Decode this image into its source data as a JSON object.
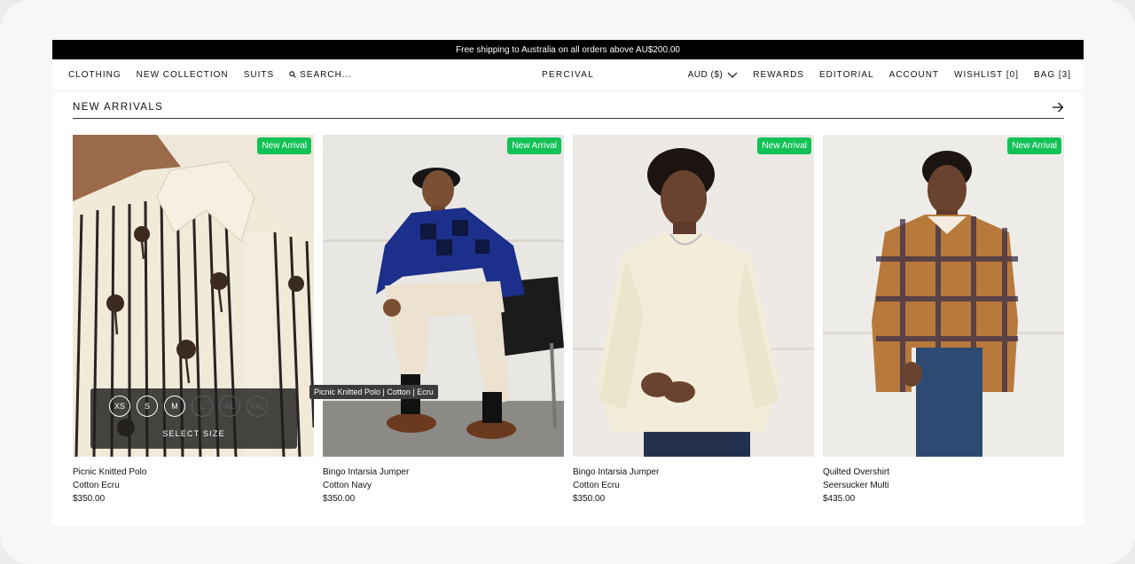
{
  "promo_bar": {
    "text": "Free shipping to Australia on all orders above AU$200.00"
  },
  "nav": {
    "left": [
      "CLOTHING",
      "NEW COLLECTION",
      "SUITS"
    ],
    "search_label": "SEARCH...",
    "brand": "PERCIVAL",
    "currency": "AUD ($)",
    "right": [
      "REWARDS",
      "EDITORIAL",
      "ACCOUNT",
      "WISHLIST [0]",
      "BAG [3]"
    ]
  },
  "section": {
    "title": "NEW ARRIVALS"
  },
  "products": [
    {
      "name": "Picnic Knitted Polo",
      "color": "Cotton Ecru",
      "price": "$350.00",
      "badge": "New Arrival"
    },
    {
      "name": "Bingo Intarsia Jumper",
      "color": "Cotton Navy",
      "price": "$350.00",
      "badge": "New Arrival"
    },
    {
      "name": "Bingo Intarsia Jumper",
      "color": "Cotton Ecru",
      "price": "$350.00",
      "badge": "New Arrival"
    },
    {
      "name": "Quilted Overshirt",
      "color": "Seersucker Multi",
      "price": "$435.00",
      "badge": "New Arrival"
    }
  ],
  "size_selector": {
    "sizes": [
      "XS",
      "S",
      "M",
      "L",
      "XL",
      "XXL"
    ],
    "label": "SELECT SIZE"
  },
  "tooltip": {
    "text": "Picnic Knitted Polo | Cotton | Ecru"
  },
  "colors": {
    "badge": "#12c257",
    "promo_bg": "#000000"
  }
}
